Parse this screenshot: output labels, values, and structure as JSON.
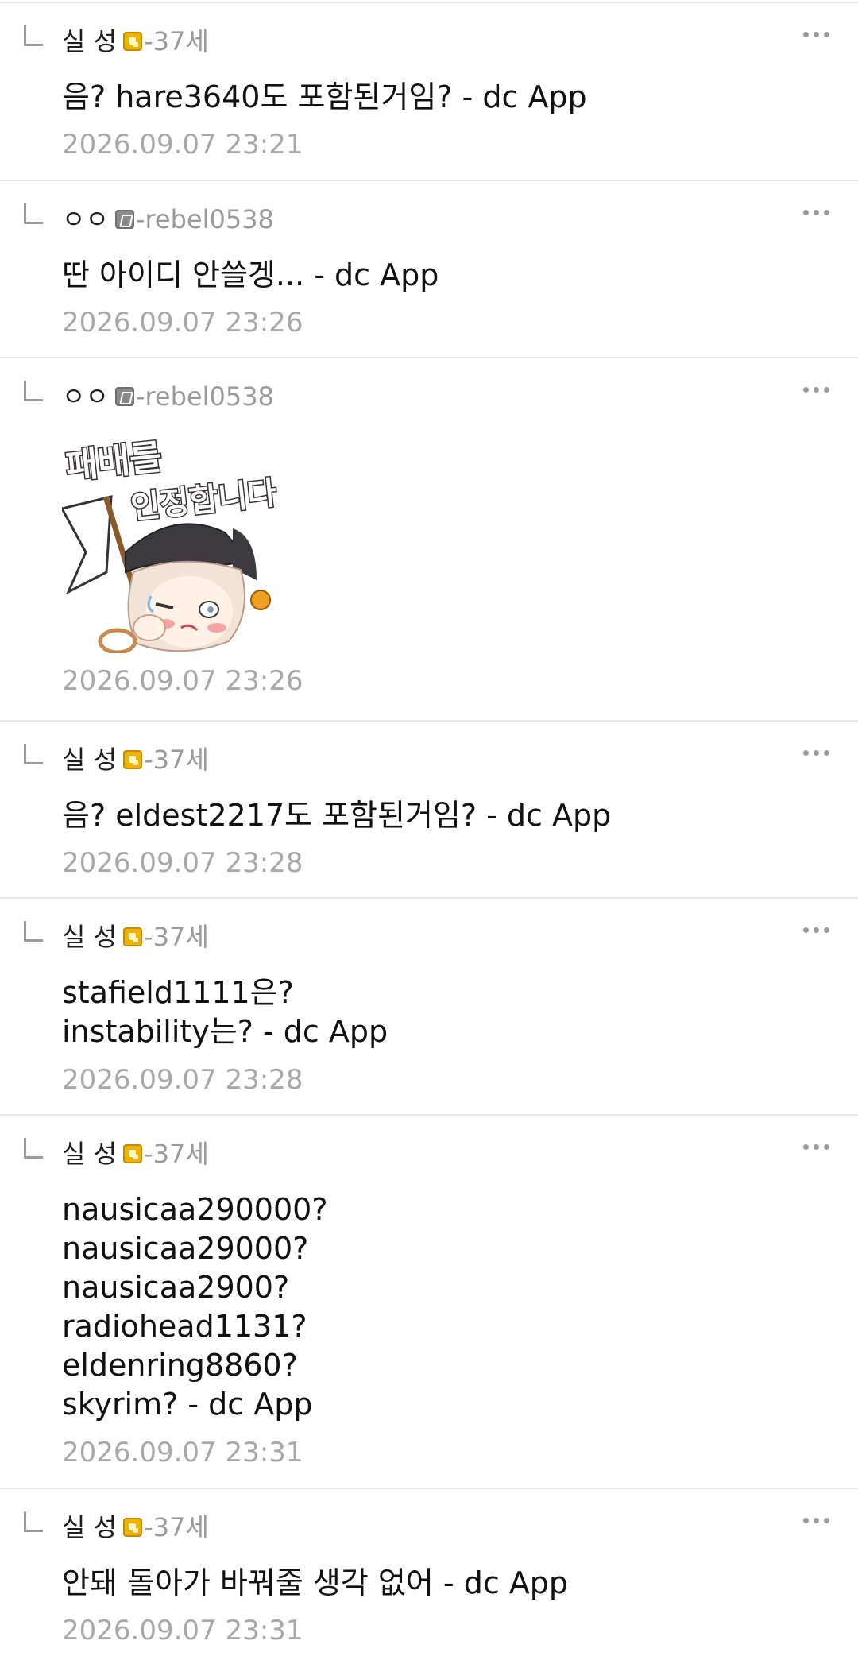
{
  "comments": [
    {
      "nick": "실 성",
      "badge": "gold",
      "uid": "-37세",
      "text": "음? hare3640도 포함된거임? - dc App",
      "time": "2026.09.07 23:21"
    },
    {
      "nick": "ㅇㅇ",
      "badge": "gray",
      "uid": "-rebel0538",
      "text": "딴 아이디 안쓸겡... - dc App",
      "time": "2026.09.07 23:26"
    },
    {
      "nick": "ㅇㅇ",
      "badge": "gray",
      "uid": "-rebel0538",
      "sticker": {
        "line1": "패배를",
        "line2": "인정합니다"
      },
      "time": "2026.09.07 23:26"
    },
    {
      "nick": "실 성",
      "badge": "gold",
      "uid": "-37세",
      "text": "음? eldest2217도 포함된거임? - dc App",
      "time": "2026.09.07 23:28"
    },
    {
      "nick": "실 성",
      "badge": "gold",
      "uid": "-37세",
      "text": "stafield1111은?\ninstability는? - dc App",
      "time": "2026.09.07 23:28"
    },
    {
      "nick": "실 성",
      "badge": "gold",
      "uid": "-37세",
      "text": "nausicaa290000?\nnausicaa29000?\nnausicaa2900?\nradiohead1131?\neldenring8860?\nskyrim? - dc App",
      "time": "2026.09.07 23:31"
    },
    {
      "nick": "실 성",
      "badge": "gold",
      "uid": "-37세",
      "text": "안돼 돌아가 바꿔줄 생각 없어 - dc App",
      "time": "2026.09.07 23:31"
    }
  ]
}
